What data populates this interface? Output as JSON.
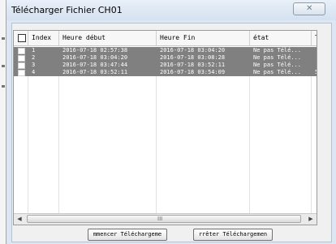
{
  "window": {
    "title": "Télécharger Fichier CH01",
    "close_symbol": "✕"
  },
  "table": {
    "columns": [
      "Index",
      "Heure début",
      "Heure Fin",
      "état",
      "T"
    ],
    "rows": [
      {
        "index": "1",
        "start": "2016-07-18 02:57:38",
        "end": "2016-07-18 03:04:20",
        "status": "Ne pas Télé...",
        "extra": ""
      },
      {
        "index": "2",
        "start": "2016-07-18 03:04:20",
        "end": "2016-07-18 03:08:28",
        "status": "Ne pas Télé...",
        "extra": ""
      },
      {
        "index": "3",
        "start": "2016-07-18 03:47:44",
        "end": "2016-07-18 03:52:11",
        "status": "Ne pas Télé...",
        "extra": ""
      },
      {
        "index": "4",
        "start": "2016-07-18 03:52:11",
        "end": "2016-07-18 03:54:09",
        "status": "Ne pas Télé...",
        "extra": "5"
      }
    ],
    "row_color": "#808080"
  },
  "scrollbar": {
    "left_arrow": "◀",
    "right_arrow": "▶",
    "grip": "III"
  },
  "buttons": {
    "start": "mmencer Téléchargeme",
    "stop": "rrêter Téléchargemen"
  },
  "icons": {
    "close": "close-icon",
    "scroll_left": "scroll-left-icon",
    "scroll_right": "scroll-right-icon"
  }
}
